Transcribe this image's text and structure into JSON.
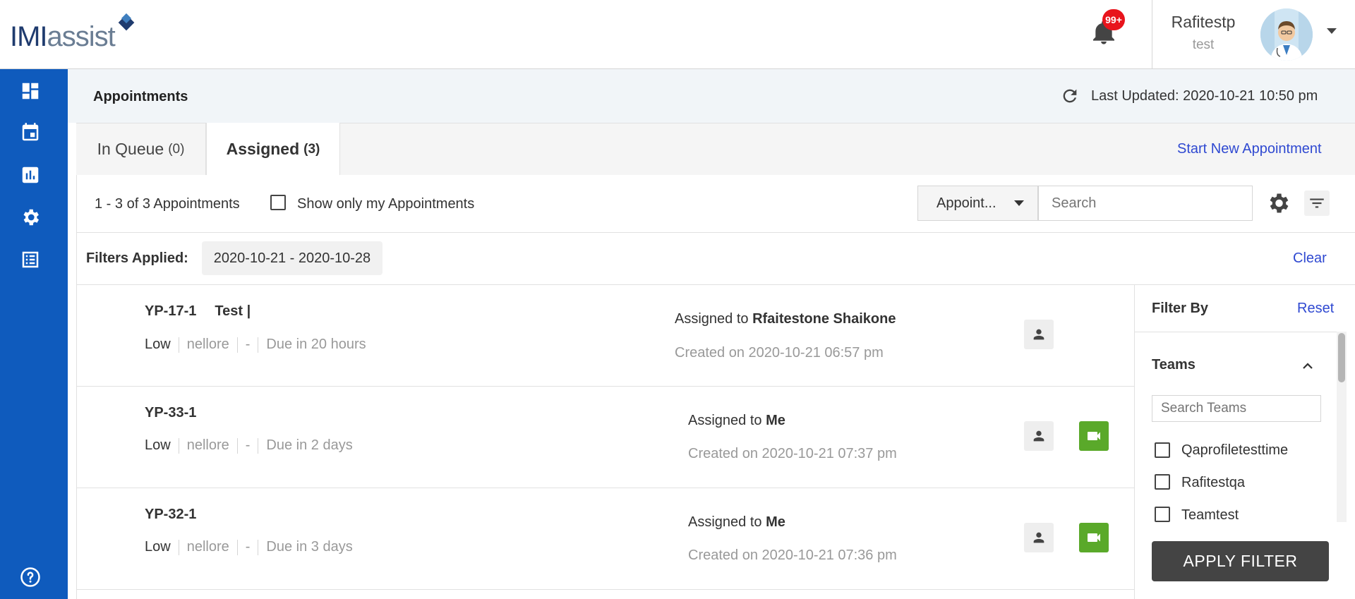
{
  "app": {
    "logo_bold": "IMI",
    "logo_light": "assist"
  },
  "header": {
    "notification_badge": "99+",
    "user_name": "Rafitestp",
    "user_role": "test"
  },
  "sidebar": {
    "items": [
      {
        "name": "dashboard-icon"
      },
      {
        "name": "calendar-icon"
      },
      {
        "name": "bar-chart-icon"
      },
      {
        "name": "gear-icon"
      },
      {
        "name": "list-icon"
      }
    ],
    "help_icon": "help-icon"
  },
  "page": {
    "title": "Appointments",
    "last_updated": "Last Updated: 2020-10-21 10:50 pm"
  },
  "tabs": [
    {
      "label": "In Queue",
      "count": "(0)",
      "active": false
    },
    {
      "label": "Assigned",
      "count": "(3)",
      "active": true
    }
  ],
  "start_new": "Start New Appointment",
  "toolbar": {
    "count_text": "1 - 3 of 3 Appointments",
    "show_mine_label": "Show only my Appointments",
    "select_value": "Appoint...",
    "search_placeholder": "Search"
  },
  "filters": {
    "label": "Filters Applied:",
    "chips": [
      "2020-10-21 - 2020-10-28"
    ],
    "clear": "Clear"
  },
  "appointments": [
    {
      "id": "YP-17-1",
      "title": "Test |",
      "priority": "Low",
      "location": "nellore",
      "dash": "-",
      "due": "Due in 20 hours",
      "assigned_prefix": "Assigned to",
      "assigned_to": "Rfaitestone Shaikone",
      "created": "Created on 2020-10-21 06:57 pm",
      "video": false
    },
    {
      "id": "YP-33-1",
      "title": "",
      "priority": "Low",
      "location": "nellore",
      "dash": "-",
      "due": "Due in 2 days",
      "assigned_prefix": "Assigned to",
      "assigned_to": "Me",
      "created": "Created on 2020-10-21 07:37 pm",
      "video": true
    },
    {
      "id": "YP-32-1",
      "title": "",
      "priority": "Low",
      "location": "nellore",
      "dash": "-",
      "due": "Due in 3 days",
      "assigned_prefix": "Assigned to",
      "assigned_to": "Me",
      "created": "Created on 2020-10-21 07:36 pm",
      "video": true
    }
  ],
  "filter_panel": {
    "title": "Filter By",
    "reset": "Reset",
    "teams_title": "Teams",
    "teams_search_placeholder": "Search Teams",
    "teams": [
      "Qaprofiletesttime",
      "Rafitestqa",
      "Teamtest"
    ],
    "apply": "APPLY FILTER"
  },
  "colors": {
    "sidebar": "#0f5bbd",
    "link": "#2f49d1",
    "badge": "#e8141c",
    "video": "#5aa92a",
    "apply_button": "#444444"
  }
}
